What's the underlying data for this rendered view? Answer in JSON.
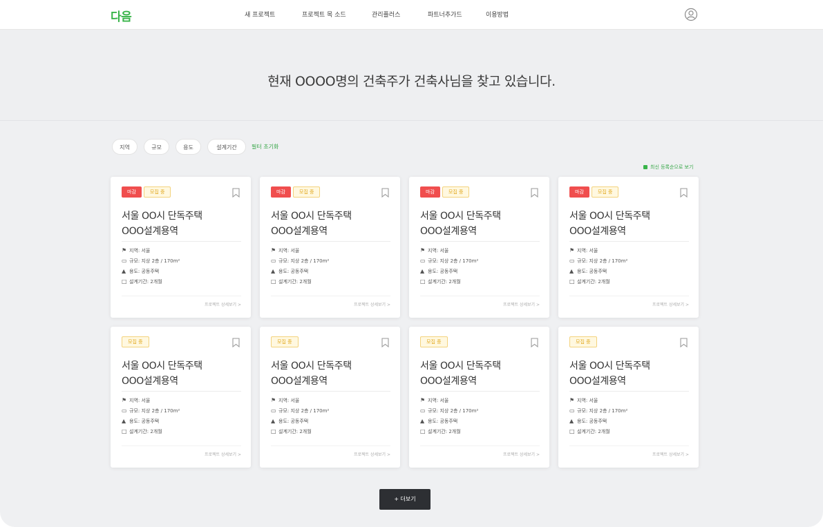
{
  "header": {
    "logo": "다음",
    "nav": [
      "새 프로젝트",
      "프로젝트 목 소드",
      "관리플러스",
      "파트너추가드",
      "이용방법"
    ]
  },
  "hero": {
    "title": "현재 OOOO명의 건축주가 건축사님을 찾고 있습니다."
  },
  "filters": {
    "chips": [
      "지역",
      "규모",
      "용도",
      "설계기간"
    ],
    "reset_label": "필터 초기화"
  },
  "sort_label": "최신 등록순으로 보기",
  "cards": [
    {
      "badges": [
        "마감",
        "모집 중"
      ],
      "title_line1": "서울 OO시 단독주택",
      "title_line2": "OOO설계용역",
      "region": "지역: 서울",
      "area": "규모: 지상 2층 / 170m²",
      "use": "용도: 공동주택",
      "period": "설계기간: 2개월",
      "more": "프로젝트 상세보기 >"
    },
    {
      "badges": [
        "마감",
        "모집 중"
      ],
      "title_line1": "서울 OO시 단독주택",
      "title_line2": "OOO설계용역",
      "region": "지역: 서울",
      "area": "규모: 지상 2층 / 170m²",
      "use": "용도: 공동주택",
      "period": "설계기간: 2개월",
      "more": "프로젝트 상세보기 >"
    },
    {
      "badges": [
        "마감",
        "모집 중"
      ],
      "title_line1": "서울 OO시 단독주택",
      "title_line2": "OOO설계용역",
      "region": "지역: 서울",
      "area": "규모: 지상 2층 / 170m²",
      "use": "용도: 공동주택",
      "period": "설계기간: 2개월",
      "more": "프로젝트 상세보기 >"
    },
    {
      "badges": [
        "마감",
        "모집 중"
      ],
      "title_line1": "서울 OO시 단독주택",
      "title_line2": "OOO설계용역",
      "region": "지역: 서울",
      "area": "규모: 지상 2층 / 170m²",
      "use": "용도: 공동주택",
      "period": "설계기간: 2개월",
      "more": "프로젝트 상세보기 >"
    },
    {
      "badges": [
        "모집 중"
      ],
      "title_line1": "서울 OO시 단독주택",
      "title_line2": "OOO설계용역",
      "region": "지역: 서울",
      "area": "규모: 지상 2층 / 170m²",
      "use": "용도: 공동주택",
      "period": "설계기간: 2개월",
      "more": "프로젝트 상세보기 >"
    },
    {
      "badges": [
        "모집 중"
      ],
      "title_line1": "서울 OO시 단독주택",
      "title_line2": "OOO설계용역",
      "region": "지역: 서울",
      "area": "규모: 지상 2층 / 170m²",
      "use": "용도: 공동주택",
      "period": "설계기간: 2개월",
      "more": "프로젝트 상세보기 >"
    },
    {
      "badges": [
        "모집 중"
      ],
      "title_line1": "서울 OO시 단독주택",
      "title_line2": "OOO설계용역",
      "region": "지역: 서울",
      "area": "규모: 지상 2층 / 170m²",
      "use": "용도: 공동주택",
      "period": "설계기간: 2개월",
      "more": "프로젝트 상세보기 >"
    },
    {
      "badges": [
        "모집 중"
      ],
      "title_line1": "서울 OO시 단독주택",
      "title_line2": "OOO설계용역",
      "region": "지역: 서울",
      "area": "규모: 지상 2층 / 170m²",
      "use": "용도: 공동주택",
      "period": "설계기간: 2개월",
      "more": "프로젝트 상세보기 >"
    }
  ],
  "more_button_label": "+ 더보기",
  "colors": {
    "brand": "#39b44a",
    "badge_closed": "#f04e4e",
    "badge_open": "#e1a81e",
    "more_button": "#2d2f33"
  },
  "icons": {
    "user": "user-icon",
    "bookmark": "bookmark-icon",
    "region": "pin-icon",
    "area": "ruler-icon",
    "use": "building-icon",
    "period": "calendar-icon"
  }
}
